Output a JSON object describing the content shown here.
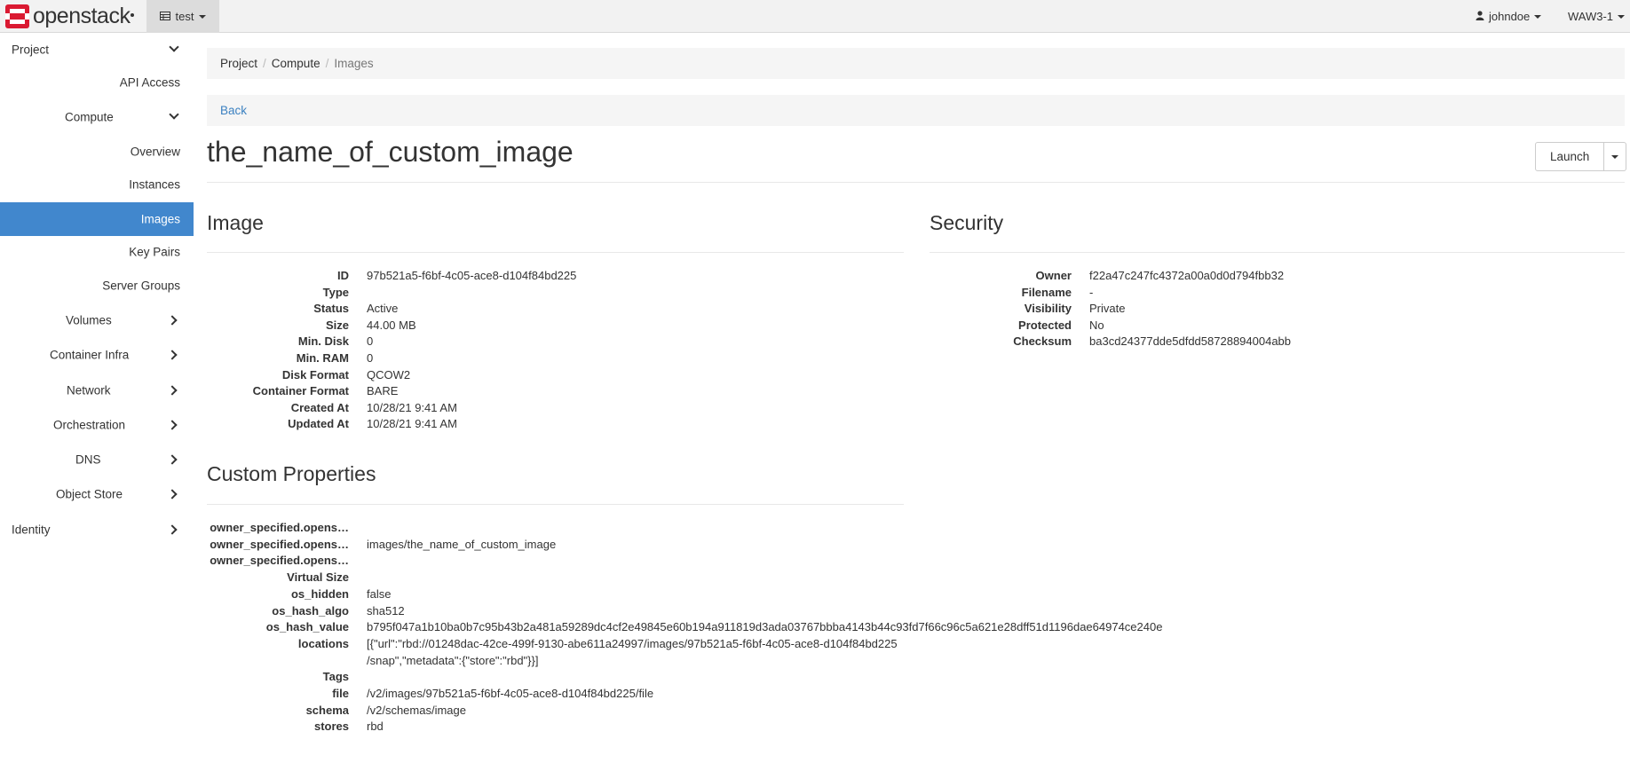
{
  "navbar": {
    "brand": "openstack",
    "project": "test",
    "user": "johndoe",
    "region": "WAW3-1"
  },
  "sidebar": {
    "project": "Project",
    "api_access": "API Access",
    "compute": "Compute",
    "overview": "Overview",
    "instances": "Instances",
    "images": "Images",
    "key_pairs": "Key Pairs",
    "server_groups": "Server Groups",
    "volumes": "Volumes",
    "container_infra": "Container Infra",
    "network": "Network",
    "orchestration": "Orchestration",
    "dns": "DNS",
    "object_store": "Object Store",
    "identity": "Identity"
  },
  "breadcrumb": {
    "project": "Project",
    "compute": "Compute",
    "images": "Images",
    "sep": "/"
  },
  "back_label": "Back",
  "page_title": "the_name_of_custom_image",
  "launch_label": "Launch",
  "image_section": {
    "title": "Image",
    "rows": [
      {
        "k": "ID",
        "v": "97b521a5-f6bf-4c05-ace8-d104f84bd225"
      },
      {
        "k": "Type",
        "v": ""
      },
      {
        "k": "Status",
        "v": "Active"
      },
      {
        "k": "Size",
        "v": "44.00 MB"
      },
      {
        "k": "Min. Disk",
        "v": "0"
      },
      {
        "k": "Min. RAM",
        "v": "0"
      },
      {
        "k": "Disk Format",
        "v": "QCOW2"
      },
      {
        "k": "Container Format",
        "v": "BARE"
      },
      {
        "k": "Created At",
        "v": "10/28/21 9:41 AM"
      },
      {
        "k": "Updated At",
        "v": "10/28/21 9:41 AM"
      }
    ]
  },
  "security_section": {
    "title": "Security",
    "rows": [
      {
        "k": "Owner",
        "v": "f22a47c247fc4372a00a0d0d794fbb32"
      },
      {
        "k": "Filename",
        "v": "-"
      },
      {
        "k": "Visibility",
        "v": "Private"
      },
      {
        "k": "Protected",
        "v": "No"
      },
      {
        "k": "Checksum",
        "v": "ba3cd24377dde5dfdd58728894004abb"
      }
    ]
  },
  "custom_section": {
    "title": "Custom Properties",
    "rows": [
      {
        "k": "owner_specified.opens…",
        "v": ""
      },
      {
        "k": "owner_specified.opens…",
        "v": "images/the_name_of_custom_image"
      },
      {
        "k": "owner_specified.opens…",
        "v": ""
      },
      {
        "k": "Virtual Size",
        "v": ""
      },
      {
        "k": "os_hidden",
        "v": "false"
      },
      {
        "k": "os_hash_algo",
        "v": "sha512"
      },
      {
        "k": "os_hash_value",
        "v": "b795f047a1b10ba0b7c95b43b2a481a59289dc4cf2e49845e60b194a911819d3ada03767bbba4143b44c93fd7f66c96c5a621e28dff51d1196dae64974ce240e"
      },
      {
        "k": "locations",
        "v": "[{\"url\":\"rbd://01248dac-42ce-499f-9130-abe611a24997/images/97b521a5-f6bf-4c05-ace8-d104f84bd225",
        "v2": "/snap\",\"metadata\":{\"store\":\"rbd\"}}]"
      },
      {
        "k": "Tags",
        "v": ""
      },
      {
        "k": "file",
        "v": "/v2/images/97b521a5-f6bf-4c05-ace8-d104f84bd225/file"
      },
      {
        "k": "schema",
        "v": "/v2/schemas/image"
      },
      {
        "k": "stores",
        "v": "rbd"
      }
    ]
  },
  "icons": {
    "logo": "openstack-logo-icon",
    "project": "project-table-icon",
    "user": "user-icon"
  },
  "colors": {
    "accent": "#4187cd",
    "link": "#3c81c1",
    "logo_red": "#da1a32"
  }
}
